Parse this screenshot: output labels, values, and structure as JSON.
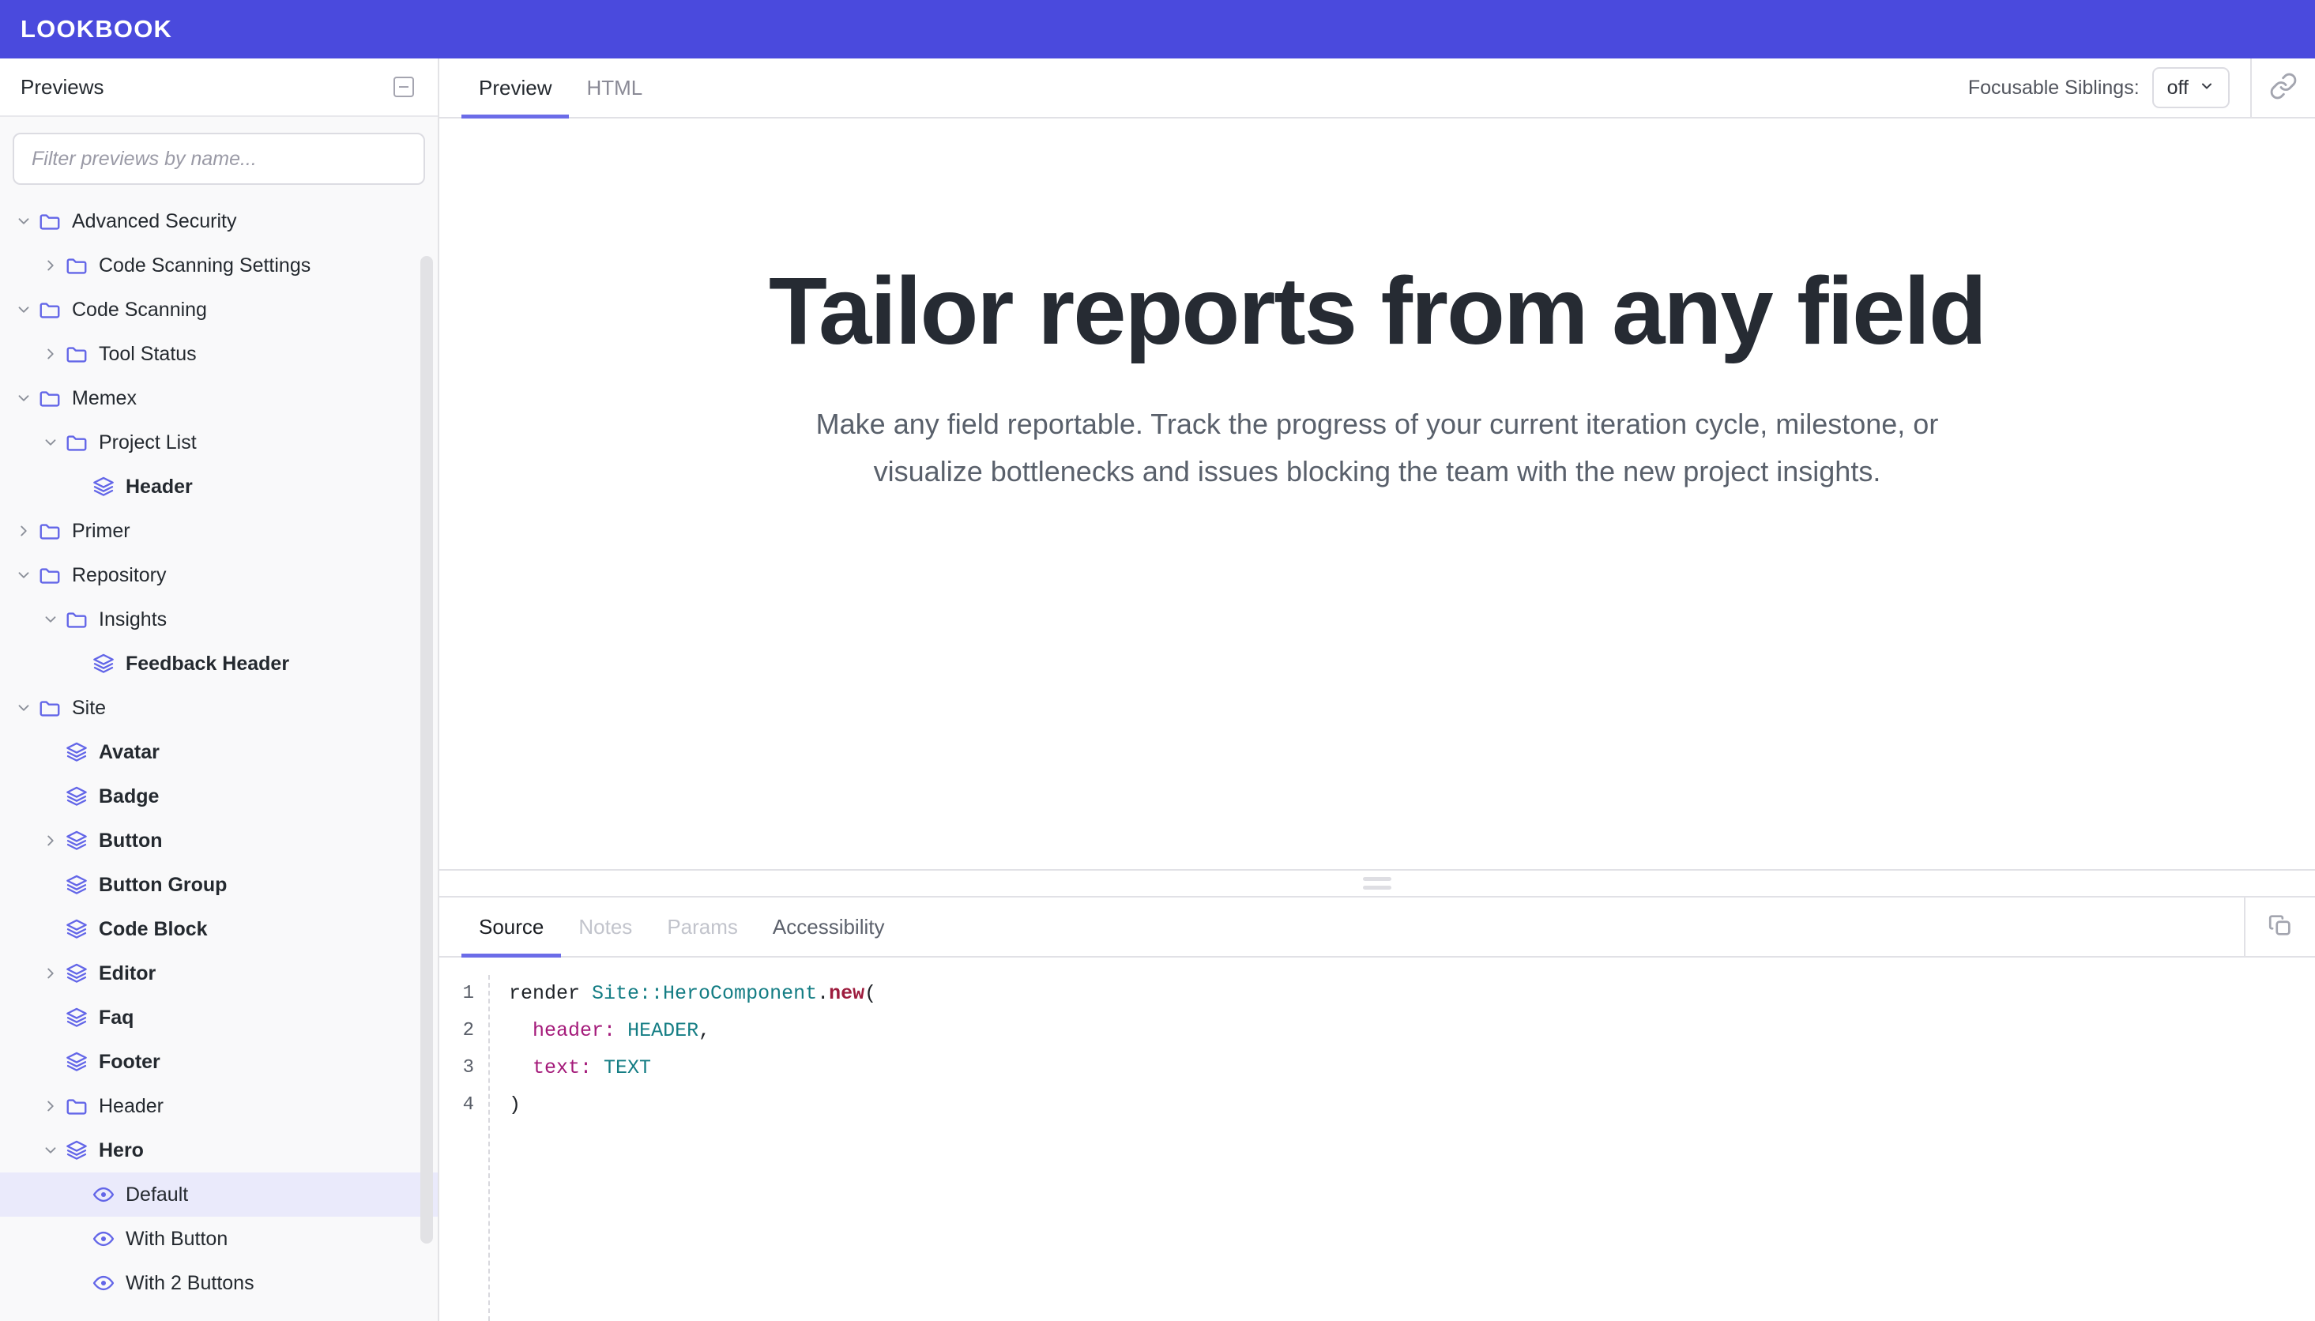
{
  "brand": {
    "name": "LOOKBOOK"
  },
  "sidebar": {
    "title": "Previews",
    "collapse_icon": "collapse-all-icon",
    "filter": {
      "placeholder": "Filter previews by name...",
      "value": ""
    },
    "tree": [
      {
        "label": "Advanced Security",
        "icon": "folder-icon",
        "chevron": "down",
        "depth": 0,
        "bold": false,
        "selected": false
      },
      {
        "label": "Code Scanning Settings",
        "icon": "folder-icon",
        "chevron": "right",
        "depth": 1,
        "bold": false,
        "selected": false
      },
      {
        "label": "Code Scanning",
        "icon": "folder-icon",
        "chevron": "down",
        "depth": 0,
        "bold": false,
        "selected": false
      },
      {
        "label": "Tool Status",
        "icon": "folder-icon",
        "chevron": "right",
        "depth": 1,
        "bold": false,
        "selected": false
      },
      {
        "label": "Memex",
        "icon": "folder-icon",
        "chevron": "down",
        "depth": 0,
        "bold": false,
        "selected": false
      },
      {
        "label": "Project List",
        "icon": "folder-icon",
        "chevron": "down",
        "depth": 1,
        "bold": false,
        "selected": false
      },
      {
        "label": "Header",
        "icon": "layers-icon",
        "chevron": "none",
        "depth": 2,
        "bold": true,
        "selected": false
      },
      {
        "label": "Primer",
        "icon": "folder-icon",
        "chevron": "right",
        "depth": 0,
        "bold": false,
        "selected": false
      },
      {
        "label": "Repository",
        "icon": "folder-icon",
        "chevron": "down",
        "depth": 0,
        "bold": false,
        "selected": false
      },
      {
        "label": "Insights",
        "icon": "folder-icon",
        "chevron": "down",
        "depth": 1,
        "bold": false,
        "selected": false
      },
      {
        "label": "Feedback Header",
        "icon": "layers-icon",
        "chevron": "none",
        "depth": 2,
        "bold": true,
        "selected": false
      },
      {
        "label": "Site",
        "icon": "folder-icon",
        "chevron": "down",
        "depth": 0,
        "bold": false,
        "selected": false
      },
      {
        "label": "Avatar",
        "icon": "layers-icon",
        "chevron": "none",
        "depth": 1,
        "bold": true,
        "selected": false
      },
      {
        "label": "Badge",
        "icon": "layers-icon",
        "chevron": "none",
        "depth": 1,
        "bold": true,
        "selected": false
      },
      {
        "label": "Button",
        "icon": "layers-icon",
        "chevron": "right",
        "depth": 1,
        "bold": true,
        "selected": false
      },
      {
        "label": "Button Group",
        "icon": "layers-icon",
        "chevron": "none",
        "depth": 1,
        "bold": true,
        "selected": false
      },
      {
        "label": "Code Block",
        "icon": "layers-icon",
        "chevron": "none",
        "depth": 1,
        "bold": true,
        "selected": false
      },
      {
        "label": "Editor",
        "icon": "layers-icon",
        "chevron": "right",
        "depth": 1,
        "bold": true,
        "selected": false
      },
      {
        "label": "Faq",
        "icon": "layers-icon",
        "chevron": "none",
        "depth": 1,
        "bold": true,
        "selected": false
      },
      {
        "label": "Footer",
        "icon": "layers-icon",
        "chevron": "none",
        "depth": 1,
        "bold": true,
        "selected": false
      },
      {
        "label": "Header",
        "icon": "folder-icon",
        "chevron": "right",
        "depth": 1,
        "bold": false,
        "selected": false
      },
      {
        "label": "Hero",
        "icon": "layers-icon",
        "chevron": "down",
        "depth": 1,
        "bold": true,
        "selected": false
      },
      {
        "label": "Default",
        "icon": "eye-icon",
        "chevron": "none",
        "depth": 2,
        "bold": false,
        "selected": true
      },
      {
        "label": "With Button",
        "icon": "eye-icon",
        "chevron": "none",
        "depth": 2,
        "bold": false,
        "selected": false
      },
      {
        "label": "With 2 Buttons",
        "icon": "eye-icon",
        "chevron": "none",
        "depth": 2,
        "bold": false,
        "selected": false
      }
    ]
  },
  "toolbar": {
    "tabs": [
      {
        "label": "Preview",
        "active": true
      },
      {
        "label": "HTML",
        "active": false
      }
    ],
    "focusable_siblings_label": "Focusable Siblings:",
    "focusable_siblings_value": "off",
    "link_icon": "link-icon"
  },
  "preview": {
    "title": "Tailor reports from any field",
    "text": "Make any field reportable. Track the progress of your current iteration cycle, milestone, or visualize bottlenecks and issues blocking the team with the new project insights."
  },
  "inspector": {
    "tabs": [
      {
        "label": "Source",
        "active": true,
        "muted": false
      },
      {
        "label": "Notes",
        "active": false,
        "muted": true
      },
      {
        "label": "Params",
        "active": false,
        "muted": true
      },
      {
        "label": "Accessibility",
        "active": false,
        "muted": false
      }
    ],
    "copy_icon": "copy-icon",
    "code": {
      "line_numbers": [
        "1",
        "2",
        "3",
        "4"
      ],
      "lines": [
        [
          {
            "t": "render ",
            "c": "plain"
          },
          {
            "t": "Site::HeroComponent",
            "c": "const"
          },
          {
            "t": ".",
            "c": "plain"
          },
          {
            "t": "new",
            "c": "method"
          },
          {
            "t": "(",
            "c": "plain"
          }
        ],
        [
          {
            "t": "  ",
            "c": "plain"
          },
          {
            "t": "header:",
            "c": "key"
          },
          {
            "t": " ",
            "c": "plain"
          },
          {
            "t": "HEADER",
            "c": "const"
          },
          {
            "t": ",",
            "c": "plain"
          }
        ],
        [
          {
            "t": "  ",
            "c": "plain"
          },
          {
            "t": "text:",
            "c": "key"
          },
          {
            "t": " ",
            "c": "plain"
          },
          {
            "t": "TEXT",
            "c": "const"
          }
        ],
        [
          {
            "t": ")",
            "c": "plain"
          }
        ]
      ]
    }
  },
  "colors": {
    "brand_purple": "#4a4add",
    "accent_underline": "#6b6ce8",
    "icon_purple": "#6366e8",
    "selected_row": "#eaeafb",
    "sidebar_bg": "#f9f9fa",
    "hero_title": "#262b33",
    "hero_text": "#59606b"
  }
}
